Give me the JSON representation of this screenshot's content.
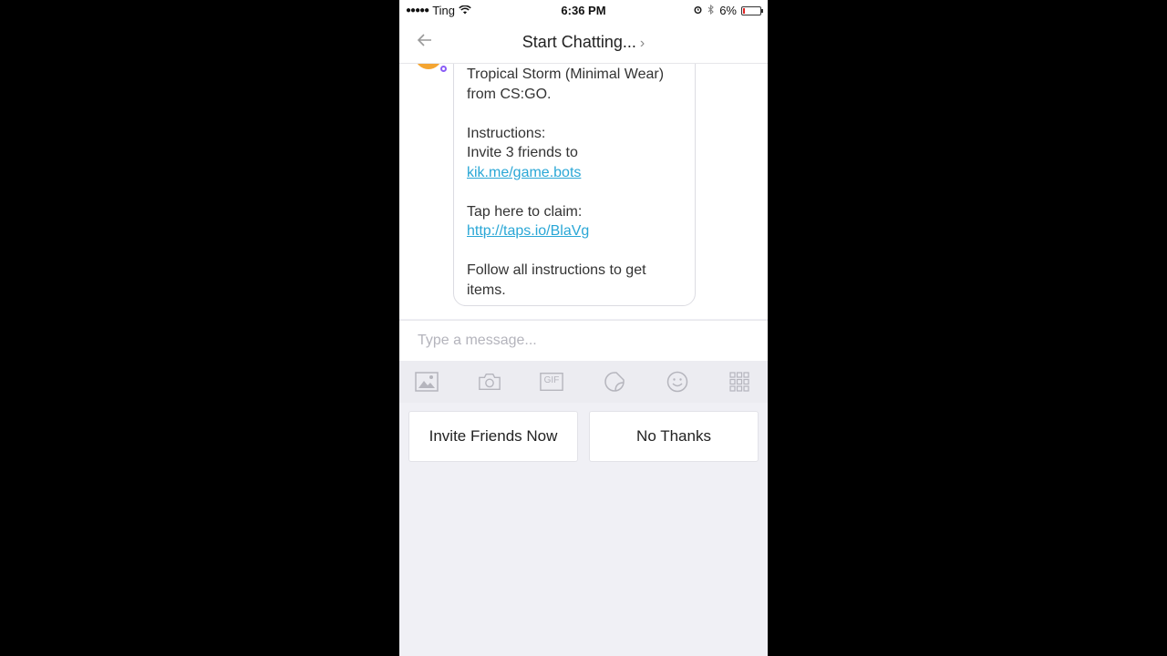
{
  "status_bar": {
    "signal": "●●●●●",
    "carrier": "Ting",
    "time": "6:36 PM",
    "battery": "6%"
  },
  "nav": {
    "back_icon": "arrow-left-icon",
    "title": "Start Chatting...",
    "title_chevron": "›"
  },
  "message": {
    "line1": "Tropical Storm (Minimal Wear)",
    "line2": "from CS:GO.",
    "instructions_label": "Instructions:",
    "instructions_text": "Invite 3 friends to",
    "instructions_link": "kik.me/game.bots",
    "claim_label": "Tap here to claim:",
    "claim_link": "http://taps.io/BlaVg",
    "footer_line1": "Follow all instructions to get",
    "footer_line2": "items."
  },
  "composer": {
    "placeholder": "Type a message..."
  },
  "toolbar": {
    "icons": [
      "image-icon",
      "camera-icon",
      "gif-icon",
      "sticker-icon",
      "smiley-icon",
      "grid-icon"
    ],
    "gif_label": "GIF"
  },
  "suggested_replies": [
    {
      "label": "Invite Friends Now"
    },
    {
      "label": "No Thanks"
    }
  ],
  "colors": {
    "link": "#2aa7d6",
    "battery_low": "#e02424",
    "background": "#f0f0f5"
  }
}
